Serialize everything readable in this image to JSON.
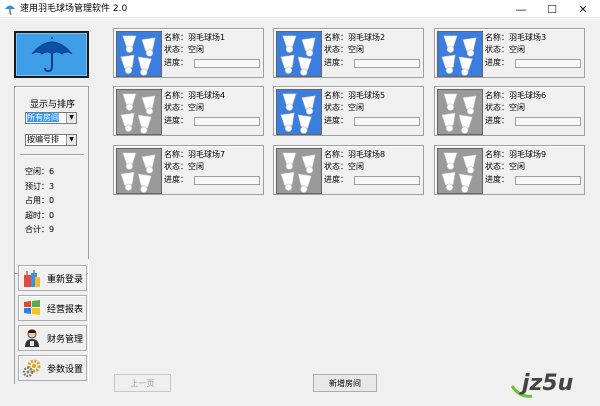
{
  "window": {
    "title": "速用羽毛球场管理软件 2.0",
    "min_symbol": "—",
    "max_symbol": "☐",
    "close_symbol": "✕"
  },
  "sidebar": {
    "sort_title": "显示与排序",
    "filter_select": "所有房间",
    "sort_select": "按编号排",
    "stats": [
      "空闲：6",
      "预订：3",
      "占用：0",
      "超时：0",
      "合计：9"
    ],
    "nav": [
      {
        "label": "重新登录",
        "icon": "gift-icon"
      },
      {
        "label": "经营报表",
        "icon": "windows-logo-icon"
      },
      {
        "label": "财务管理",
        "icon": "person-icon"
      },
      {
        "label": "参数设置",
        "icon": "gear-icon"
      }
    ]
  },
  "courts": [
    {
      "name": "名称：羽毛球场1",
      "status": "状态：空闲",
      "progress": "进度：",
      "selected": true
    },
    {
      "name": "名称：羽毛球场2",
      "status": "状态：空闲",
      "progress": "进度：",
      "selected": true
    },
    {
      "name": "名称：羽毛球场3",
      "status": "状态：空闲",
      "progress": "进度：",
      "selected": true
    },
    {
      "name": "名称：羽毛球场4",
      "status": "状态：空闲",
      "progress": "进度：",
      "selected": false
    },
    {
      "name": "名称：羽毛球场5",
      "status": "状态：空闲",
      "progress": "进度：",
      "selected": true
    },
    {
      "name": "名称：羽毛球场6",
      "status": "状态：空闲",
      "progress": "进度：",
      "selected": false
    },
    {
      "name": "名称：羽毛球场7",
      "status": "状态：空闲",
      "progress": "进度：",
      "selected": false
    },
    {
      "name": "名称：羽毛球场8",
      "status": "状态：空闲",
      "progress": "进度：",
      "selected": false
    },
    {
      "name": "名称：羽毛球场9",
      "status": "状态：空闲",
      "progress": "进度：",
      "selected": false
    }
  ],
  "footer": {
    "prev_label": "上一页",
    "new_room_label": "新增房间"
  },
  "watermark": {
    "text": "jz5u"
  },
  "colors": {
    "selected_thumb": "#3a7ee0",
    "idle_thumb": "#9a9a9a",
    "logo_bg": "#3e9fe8"
  }
}
